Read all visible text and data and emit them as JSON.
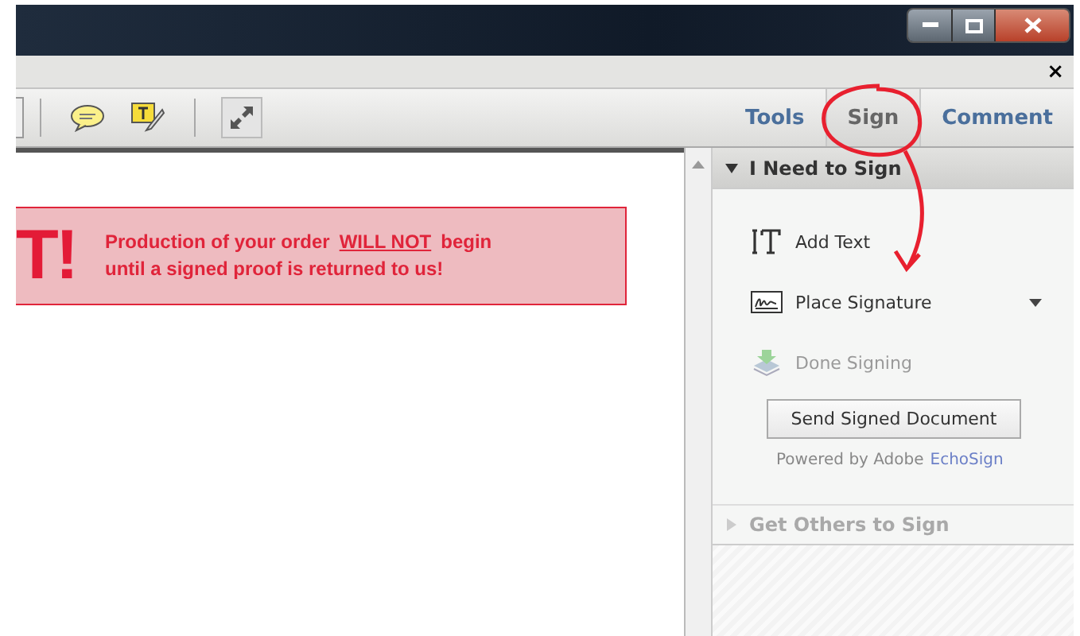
{
  "menu_strip": {
    "close_glyph": "×"
  },
  "toolbar": {
    "tabs": [
      {
        "label": "Tools",
        "selected": false
      },
      {
        "label": "Sign",
        "selected": true
      },
      {
        "label": "Comment",
        "selected": false
      }
    ]
  },
  "banner": {
    "mark": "T!",
    "before": "Production of your order",
    "emphasis": "WILL NOT",
    "after": "begin",
    "line_2": "until a signed proof is returned to us!"
  },
  "panel": {
    "sections": [
      {
        "title": "I Need to Sign",
        "expanded": true,
        "disabled": false,
        "items": [
          {
            "kind": "text",
            "label": "Add Text",
            "disabled": false
          },
          {
            "kind": "signature",
            "label": "Place Signature",
            "disabled": false
          },
          {
            "kind": "done",
            "label": "Done Signing",
            "disabled": true
          }
        ],
        "button": "Send Signed Document",
        "powered_by": "Powered by Adobe",
        "link": "EchoSign"
      },
      {
        "title": "Get Others to Sign",
        "expanded": false,
        "disabled": true
      }
    ]
  }
}
